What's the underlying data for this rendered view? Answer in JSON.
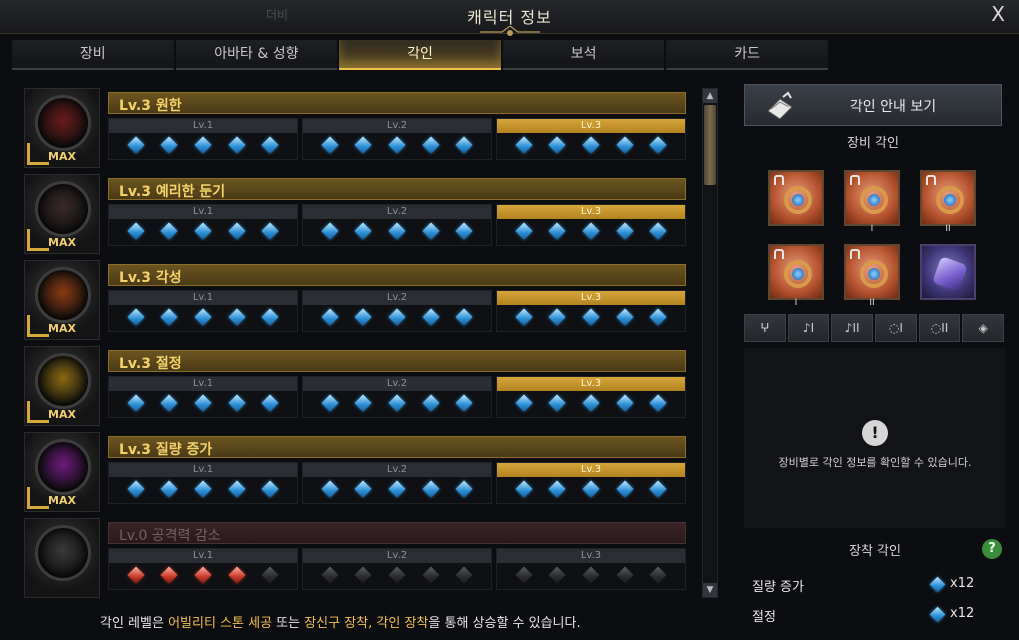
{
  "window": {
    "title": "캐릭터 정보",
    "close_label": "X",
    "background_ghost_text": "더비"
  },
  "tabs": [
    {
      "label": "장비",
      "active": false
    },
    {
      "label": "아바타 & 성향",
      "active": false
    },
    {
      "label": "각인",
      "active": true
    },
    {
      "label": "보석",
      "active": false
    },
    {
      "label": "카드",
      "active": false
    }
  ],
  "engravings": [
    {
      "name": "Lv.3 원한",
      "badge": "MAX",
      "levels": [
        "Lv.1",
        "Lv.2",
        "Lv.3"
      ],
      "current_level": 3,
      "gems": "blue"
    },
    {
      "name": "Lv.3 예리한 둔기",
      "badge": "MAX",
      "levels": [
        "Lv.1",
        "Lv.2",
        "Lv.3"
      ],
      "current_level": 3,
      "gems": "blue"
    },
    {
      "name": "Lv.3 각성",
      "badge": "MAX",
      "levels": [
        "Lv.1",
        "Lv.2",
        "Lv.3"
      ],
      "current_level": 3,
      "gems": "blue"
    },
    {
      "name": "Lv.3 절정",
      "badge": "MAX",
      "levels": [
        "Lv.1",
        "Lv.2",
        "Lv.3"
      ],
      "current_level": 3,
      "gems": "blue"
    },
    {
      "name": "Lv.3 질량 증가",
      "badge": "MAX",
      "levels": [
        "Lv.1",
        "Lv.2",
        "Lv.3"
      ],
      "current_level": 3,
      "gems": "blue"
    },
    {
      "name": "Lv.0 공격력 감소",
      "badge": "",
      "levels": [
        "Lv.1",
        "Lv.2",
        "Lv.3"
      ],
      "current_level": 0,
      "gems": "red4"
    }
  ],
  "right_panel": {
    "guide_button": "각인 안내 보기",
    "equip_title": "장비 각인",
    "filters": [
      "",
      "I",
      "II",
      "I",
      "II",
      ""
    ],
    "slots": [
      {
        "type": "necklace",
        "num": ""
      },
      {
        "type": "earring",
        "num": "I"
      },
      {
        "type": "earring",
        "num": "II"
      },
      {
        "type": "ring",
        "num": "I"
      },
      {
        "type": "ring",
        "num": "II"
      },
      {
        "type": "stone",
        "num": ""
      }
    ],
    "info_message": "장비별로 각인 정보를 확인할 수 있습니다.",
    "equipped_title": "장착 각인",
    "help_label": "?",
    "equipped": [
      {
        "label": "질량 증가",
        "count": "x12"
      },
      {
        "label": "절정",
        "count": "x12"
      }
    ]
  },
  "footer": {
    "p1": "각인 레벨은 ",
    "h1": "어빌리티 스톤 세공",
    "p2": " 또는 ",
    "h2": "장신구 장착, 각인 장착",
    "p3": "을 통해 상승할 수 있습니다."
  },
  "colors": {
    "accent_gold": "#f2c14e",
    "gem_blue": "#2b8fd6",
    "gem_red": "#c93b2b"
  }
}
